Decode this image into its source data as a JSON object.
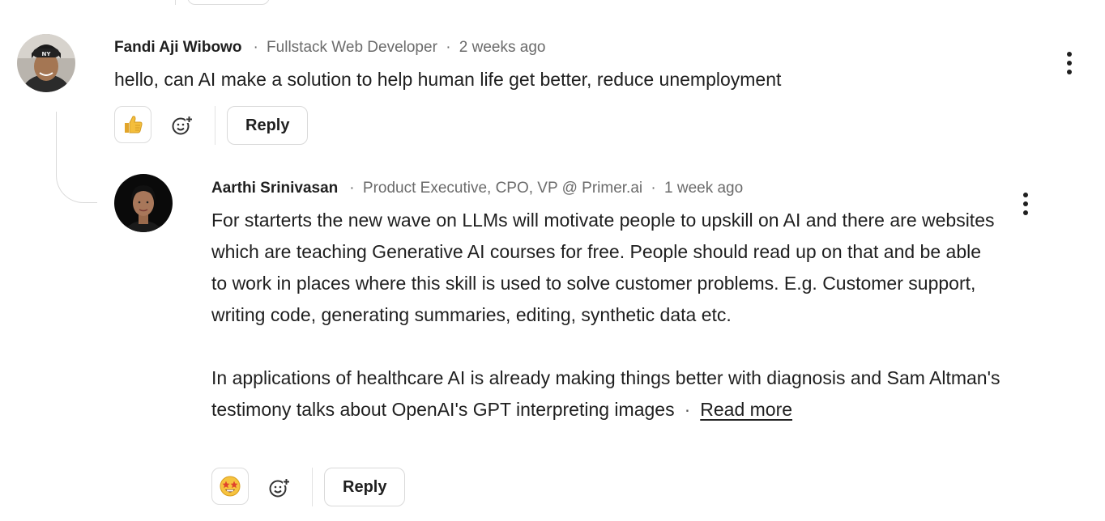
{
  "comment": {
    "author": "Fandi Aji Wibowo",
    "headline": "Fullstack Web Developer",
    "time": "2 weeks ago",
    "text": "hello, can AI make a solution to help human life get better, reduce unemployment",
    "reaction_icon": "thumbs-up-icon",
    "reply_label": "Reply"
  },
  "reply": {
    "author": "Aarthi Srinivasan",
    "headline": "Product Executive, CPO, VP @ Primer.ai",
    "time": "1 week ago",
    "paragraphs": [
      "For starterts the new wave on LLMs will motivate people to upskill on AI and there are websites which are teaching Generative AI courses for free. People should read up on that and be able to work in places where this skill is used to solve customer problems. E.g. Customer support, writing code, generating summaries, editing, synthetic data etc.",
      "In applications of healthcare AI is already making things better with diagnosis and Sam Altman's testimony talks about OpenAI's GPT interpreting images"
    ],
    "read_more": "Read more",
    "reaction_icon": "star-struck-icon",
    "reply_label": "Reply"
  },
  "separator": "·",
  "colors": {
    "text": "#1f1f1f",
    "muted": "#6b6b6b",
    "border": "#dcdcdc"
  }
}
